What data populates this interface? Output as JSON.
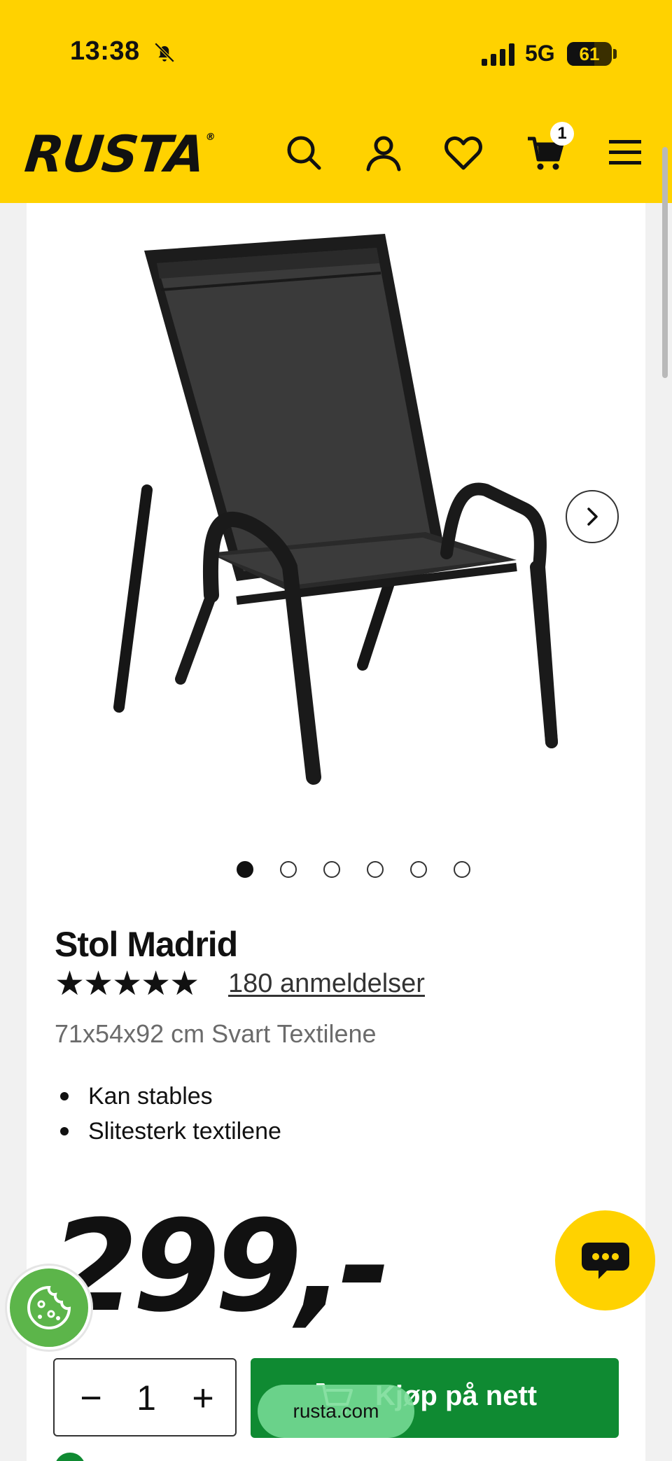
{
  "status_bar": {
    "time": "13:38",
    "network": "5G",
    "battery": "61",
    "battery_level": 0.61
  },
  "header": {
    "logo": "RUSTA",
    "logo_mark": "®",
    "cart_count": "1",
    "icons": [
      "search-icon",
      "user-icon",
      "heart-icon",
      "cart-icon",
      "menu-icon"
    ]
  },
  "gallery": {
    "image_count": 6,
    "active_index": 0
  },
  "product": {
    "title": "Stol Madrid",
    "rating": 5,
    "stars": "★★★★★",
    "reviews_label": "180 anmeldelser",
    "subtitle": "71x54x92 cm Svart Textilene",
    "features": [
      "Kan stables",
      "Slitesterk textilene"
    ],
    "price": "299,-"
  },
  "purchase": {
    "minus": "−",
    "quantity": "1",
    "plus": "+",
    "buy_label": "Kjøp på nett"
  },
  "browser": {
    "url": "rusta.com"
  },
  "colors": {
    "brand_yellow": "#ffd200",
    "buy_green": "#0f8a32",
    "cookie_green": "#5cb54a"
  }
}
